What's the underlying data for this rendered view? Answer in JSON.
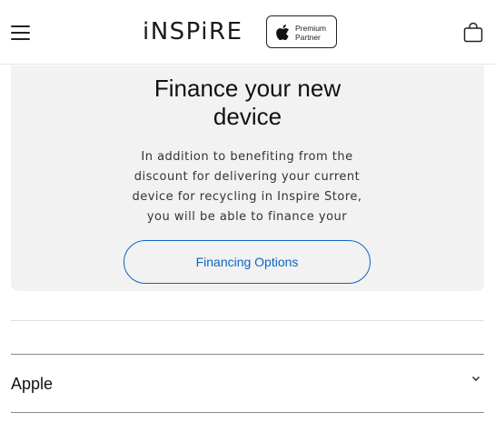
{
  "header": {
    "brand": "iNSPiRE",
    "badge": {
      "line1": "Premium",
      "line2": "Partner"
    },
    "icons": [
      "menu-icon",
      "apple-logo-icon",
      "shopping-bag-icon"
    ]
  },
  "finance": {
    "title_line1": "Finance your new",
    "title_line2": "device",
    "text_lines": [
      "In addition to benefiting from the",
      "discount for delivering your current",
      "device for recycling in Inspire Store,",
      "you will be able to finance your"
    ],
    "button_label": "Financing Options"
  },
  "accordion": {
    "apple_label": "Apple"
  },
  "colors": {
    "accent": "#0a66c2",
    "card_bg": "#f2f2f2"
  }
}
